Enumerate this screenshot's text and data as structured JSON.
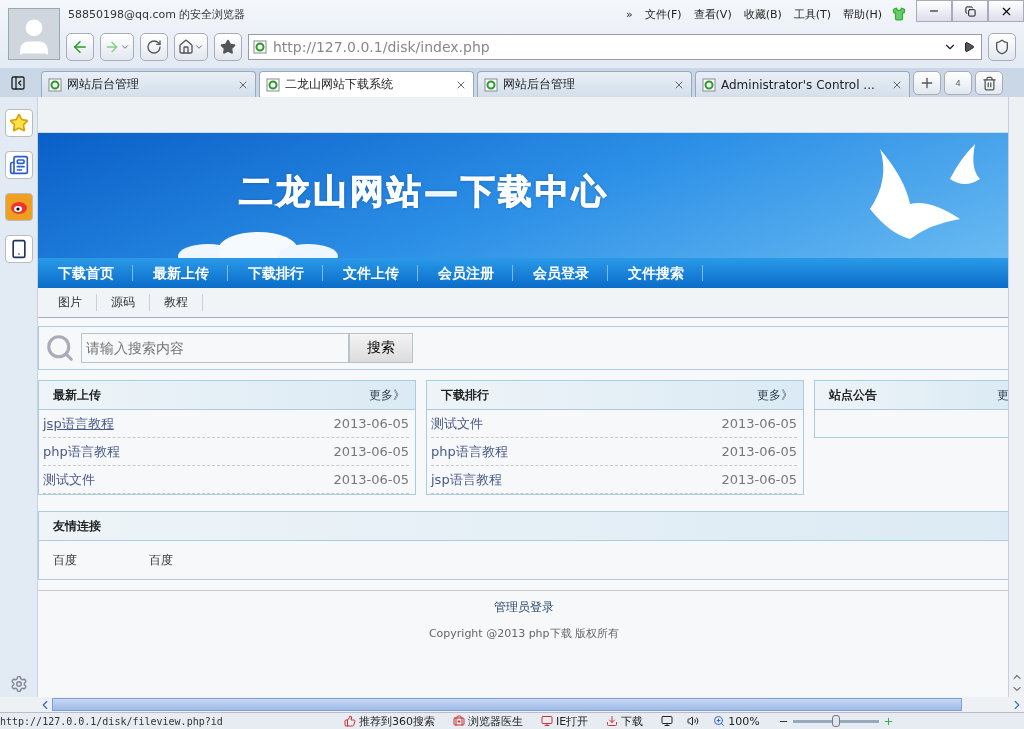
{
  "browser": {
    "title": "58850198@qq.com 的安全浏览器",
    "menu": [
      "文件(F)",
      "查看(V)",
      "收藏(B)",
      "工具(T)",
      "帮助(H)"
    ],
    "more": "»",
    "url": "http://127.0.0.1/disk/index.php",
    "tabs": [
      {
        "label": "网站后台管理",
        "selected": false
      },
      {
        "label": "二龙山网站下载系统",
        "selected": true
      },
      {
        "label": "网站后台管理",
        "selected": false
      },
      {
        "label": "Administrator's Control ...",
        "selected": false
      }
    ],
    "tab_count": "4"
  },
  "page": {
    "banner_title": "二龙山网站—下载中心",
    "nav": [
      "下载首页",
      "最新上传",
      "下载排行",
      "文件上传",
      "会员注册",
      "会员登录",
      "文件搜索"
    ],
    "subnav": [
      "图片",
      "源码",
      "教程"
    ],
    "search": {
      "placeholder": "请输入搜索内容",
      "button": "搜索"
    },
    "panels": [
      {
        "title": "最新上传",
        "more": "更多》",
        "rows": [
          {
            "name": "jsp语言教程",
            "date": "2013-06-05",
            "hovered": true
          },
          {
            "name": "php语言教程",
            "date": "2013-06-05",
            "hovered": false
          },
          {
            "name": "测试文件",
            "date": "2013-06-05",
            "hovered": false
          }
        ]
      },
      {
        "title": "下载排行",
        "more": "更多》",
        "rows": [
          {
            "name": "测试文件",
            "date": "2013-06-05",
            "hovered": false
          },
          {
            "name": "php语言教程",
            "date": "2013-06-05",
            "hovered": false
          },
          {
            "name": "jsp语言教程",
            "date": "2013-06-05",
            "hovered": false
          }
        ]
      }
    ],
    "notice": {
      "title": "站点公告",
      "more": "更"
    },
    "links": {
      "title": "友情连接",
      "items": [
        "百度",
        "百度"
      ]
    },
    "admin_link": "管理员登录",
    "copyright": "Copyright @2013 php下载 版权所有"
  },
  "status": {
    "url": "http://127.0.0.1/disk/fileview.php?id",
    "items": [
      "推荐到360搜索",
      "浏览器医生",
      "IE打开",
      "下载"
    ],
    "zoom": "100%",
    "zoom_slider": {
      "level": 0.5
    }
  }
}
